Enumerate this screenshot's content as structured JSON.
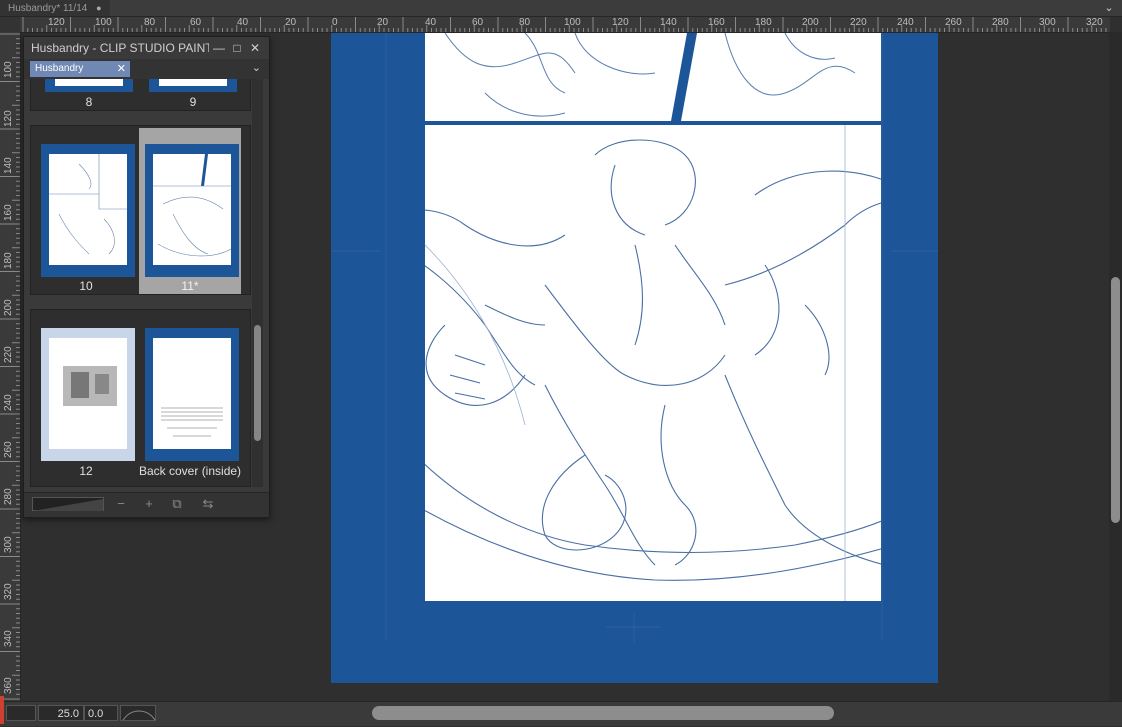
{
  "document_tab": {
    "title": "Husbandry* 11/14",
    "modified_mark": "●"
  },
  "window": {
    "chevron": "⌄"
  },
  "ruler_h": {
    "labels": [
      "120",
      "100",
      "80",
      "60",
      "40",
      "20",
      "0",
      "20",
      "40",
      "60",
      "80",
      "100",
      "120",
      "140",
      "160",
      "180",
      "200",
      "220",
      "240",
      "260",
      "280",
      "300",
      "320"
    ]
  },
  "ruler_v": {
    "labels": [
      "100",
      "120",
      "140",
      "160",
      "180",
      "200",
      "220",
      "240",
      "260",
      "280",
      "300",
      "320",
      "340",
      "360"
    ]
  },
  "page_manager": {
    "title": "Husbandry - CLIP STUDIO PAINT Pag",
    "minimize": "—",
    "maximize": "□",
    "close": "✕",
    "tab_label": "Husbandry",
    "tab_close": "✕",
    "menu_chevron": "⌄",
    "pages": [
      "8",
      "9",
      "10",
      "11*",
      "12",
      "Back cover (inside)"
    ],
    "selected_page": "11*",
    "footer_icons": [
      "minus-icon",
      "plus-icon",
      "duplicate-page-icon",
      "page-settings-icon"
    ],
    "footer_glyphs": {
      "minus": "−",
      "plus": "+",
      "duplicate": "⧉",
      "settings": "⇆"
    }
  },
  "status_bar": {
    "zoom": "25.0",
    "rotation": "0.0"
  },
  "colors": {
    "page_blue": "#1d5698",
    "ui_bg": "#2f2f2f",
    "tab_active": "#6f88b4",
    "selection": "#a5a5a5"
  }
}
